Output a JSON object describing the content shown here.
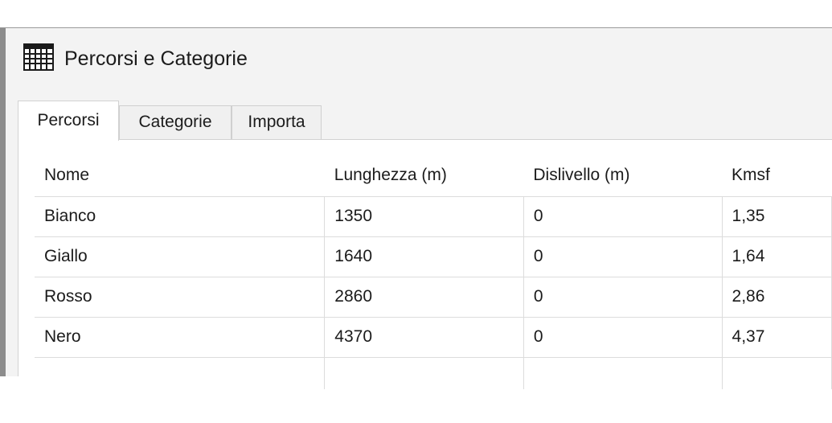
{
  "window": {
    "title": "Percorsi e Categorie",
    "icon": "table-grid-icon"
  },
  "tabs": [
    {
      "label": "Percorsi",
      "active": true
    },
    {
      "label": "Categorie",
      "active": false
    },
    {
      "label": "Importa",
      "active": false
    }
  ],
  "table": {
    "headers": [
      "Nome",
      "Lunghezza (m)",
      "Dislivello (m)",
      "Kmsf"
    ],
    "rows": [
      [
        "Bianco",
        "1350",
        "0",
        "1,35"
      ],
      [
        "Giallo",
        "1640",
        "0",
        "1,64"
      ],
      [
        "Rosso",
        "2860",
        "0",
        "2,86"
      ],
      [
        "Nero",
        "4370",
        "0",
        "4,37"
      ]
    ]
  }
}
